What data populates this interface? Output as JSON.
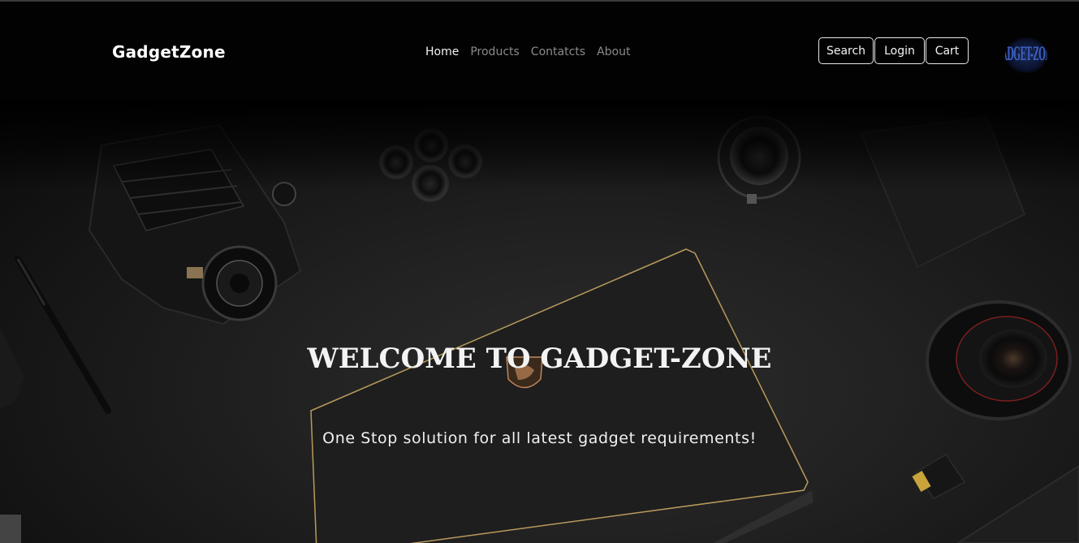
{
  "brand": "GadgetZone",
  "nav": {
    "links": [
      {
        "label": "Home",
        "active": true
      },
      {
        "label": "Products",
        "active": false
      },
      {
        "label": "Contatcts",
        "active": false
      },
      {
        "label": "About",
        "active": false
      }
    ],
    "buttons": {
      "search": "Search",
      "login": "Login",
      "cart": "Cart"
    },
    "logo_text": "GADGET-ZONE"
  },
  "hero": {
    "title": "WELCOME TO GADGET-ZONE",
    "subtitle": "One Stop solution for all latest gadget requirements!"
  },
  "colors": {
    "navbar_bg": "#020202",
    "text_primary": "#f3f3f3",
    "text_muted": "#8b8b8b",
    "laptop_trim": "#b89a5c",
    "logo_accent": "#3d5fbf"
  }
}
